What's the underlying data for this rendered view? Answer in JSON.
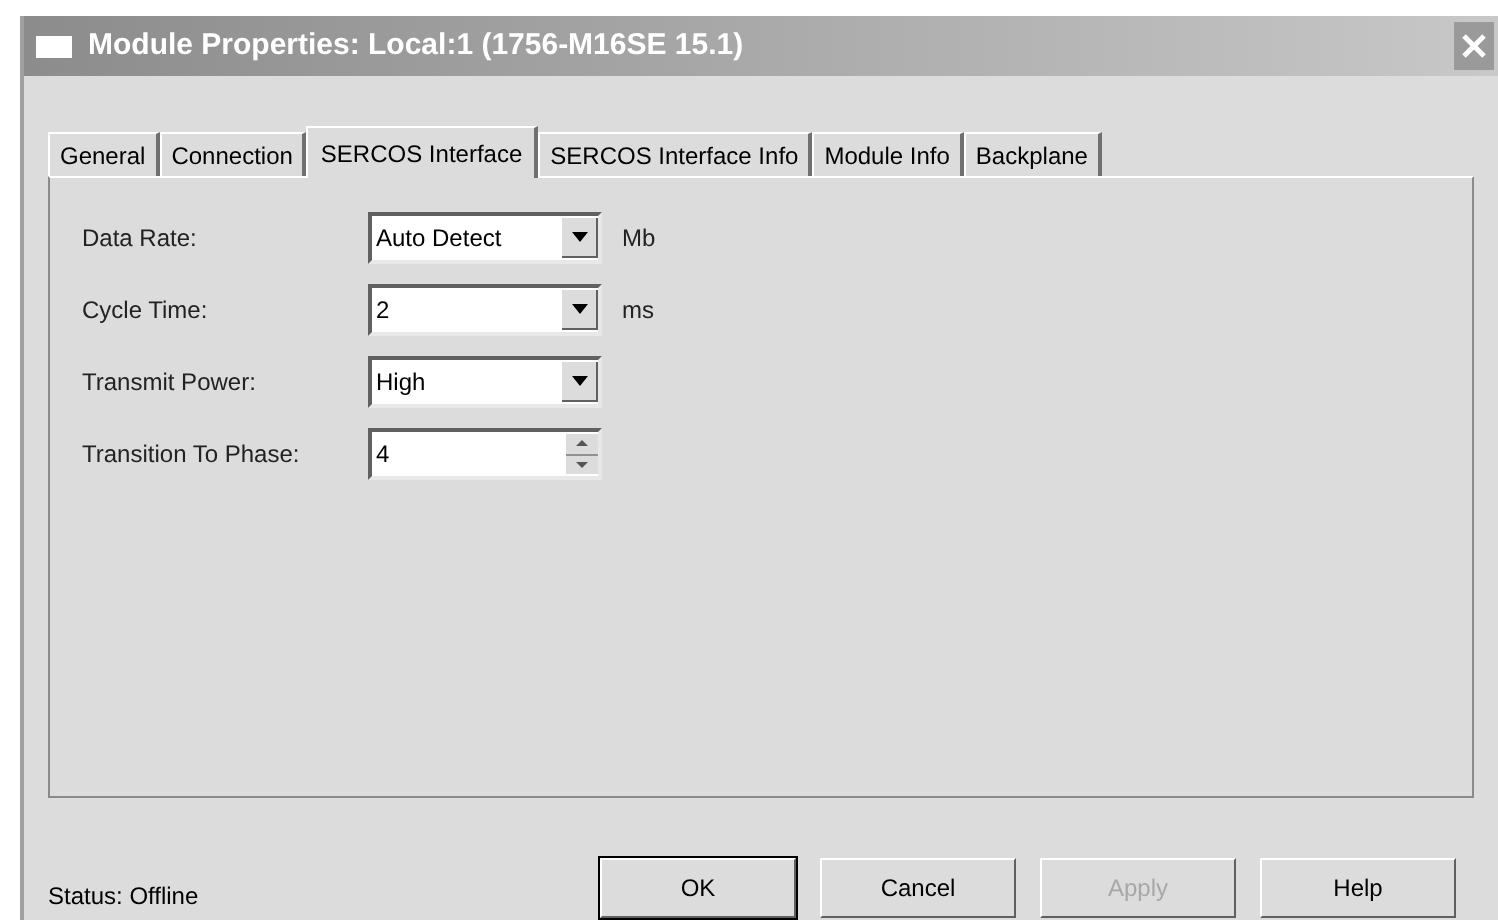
{
  "window": {
    "title": "Module Properties: Local:1 (1756-M16SE 15.1)"
  },
  "tabs": [
    {
      "label": "General",
      "selected": false
    },
    {
      "label": "Connection",
      "selected": false
    },
    {
      "label": "SERCOS Interface",
      "selected": true
    },
    {
      "label": "SERCOS Interface Info",
      "selected": false
    },
    {
      "label": "Module Info",
      "selected": false
    },
    {
      "label": "Backplane",
      "selected": false
    }
  ],
  "fields": [
    {
      "label": "Data Rate:",
      "kind": "dropdown",
      "value": "Auto Detect",
      "unit": "Mb"
    },
    {
      "label": "Cycle Time:",
      "kind": "dropdown",
      "value": "2",
      "unit": "ms"
    },
    {
      "label": "Transmit Power:",
      "kind": "dropdown",
      "value": "High"
    },
    {
      "label": "Transition To Phase:",
      "kind": "spinner",
      "value": "4"
    }
  ],
  "status_bar": {
    "text": "Status:  Offline"
  },
  "buttons": [
    {
      "label": "OK",
      "default": true,
      "disabled": false
    },
    {
      "label": "Cancel",
      "default": false,
      "disabled": false
    },
    {
      "label": "Apply",
      "default": false,
      "disabled": true
    },
    {
      "label": "Help",
      "default": false,
      "disabled": false
    }
  ]
}
